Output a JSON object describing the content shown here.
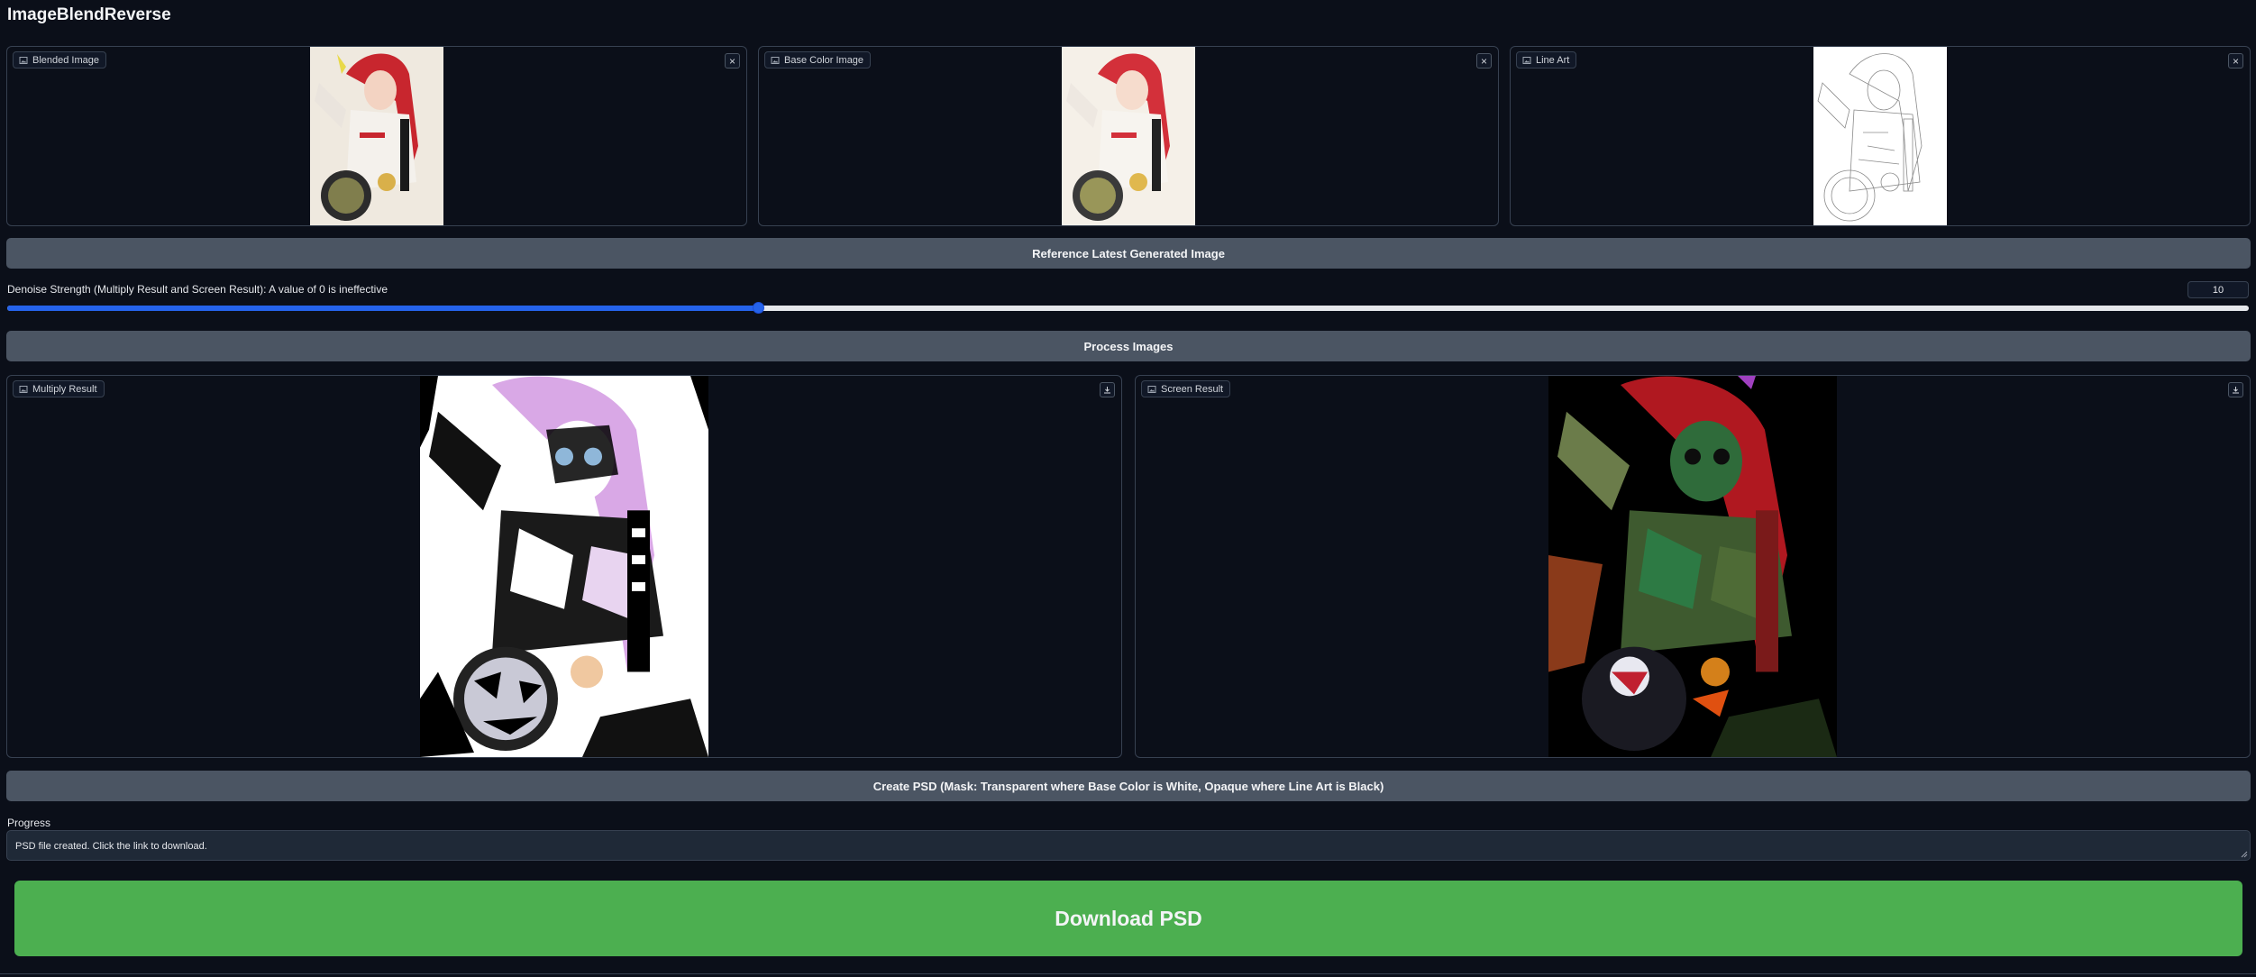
{
  "app": {
    "title": "ImageBlendReverse"
  },
  "inputs": [
    {
      "label": "Blended Image",
      "clear_icon": "close-icon"
    },
    {
      "label": "Base Color Image",
      "clear_icon": "close-icon"
    },
    {
      "label": "Line Art",
      "clear_icon": "close-icon"
    }
  ],
  "reference_button": {
    "label": "Reference Latest Generated Image"
  },
  "denoise": {
    "label": "Denoise Strength (Multiply Result and Screen Result): A value of 0 is ineffective",
    "value": "10",
    "fraction": 0.335
  },
  "process_button": {
    "label": "Process Images"
  },
  "outputs": [
    {
      "label": "Multiply Result",
      "download_icon": "download-icon"
    },
    {
      "label": "Screen Result",
      "download_icon": "download-icon"
    }
  ],
  "create_psd_button": {
    "label": "Create PSD (Mask: Transparent where Base Color is White, Opaque where Line Art is Black)"
  },
  "progress": {
    "label": "Progress",
    "value": "PSD file created. Click the link to download."
  },
  "download_button": {
    "label": "Download PSD"
  },
  "colors": {
    "background": "#0b0f19",
    "button": "#4b5563",
    "accent": "#2563eb",
    "download": "#4caf50"
  }
}
